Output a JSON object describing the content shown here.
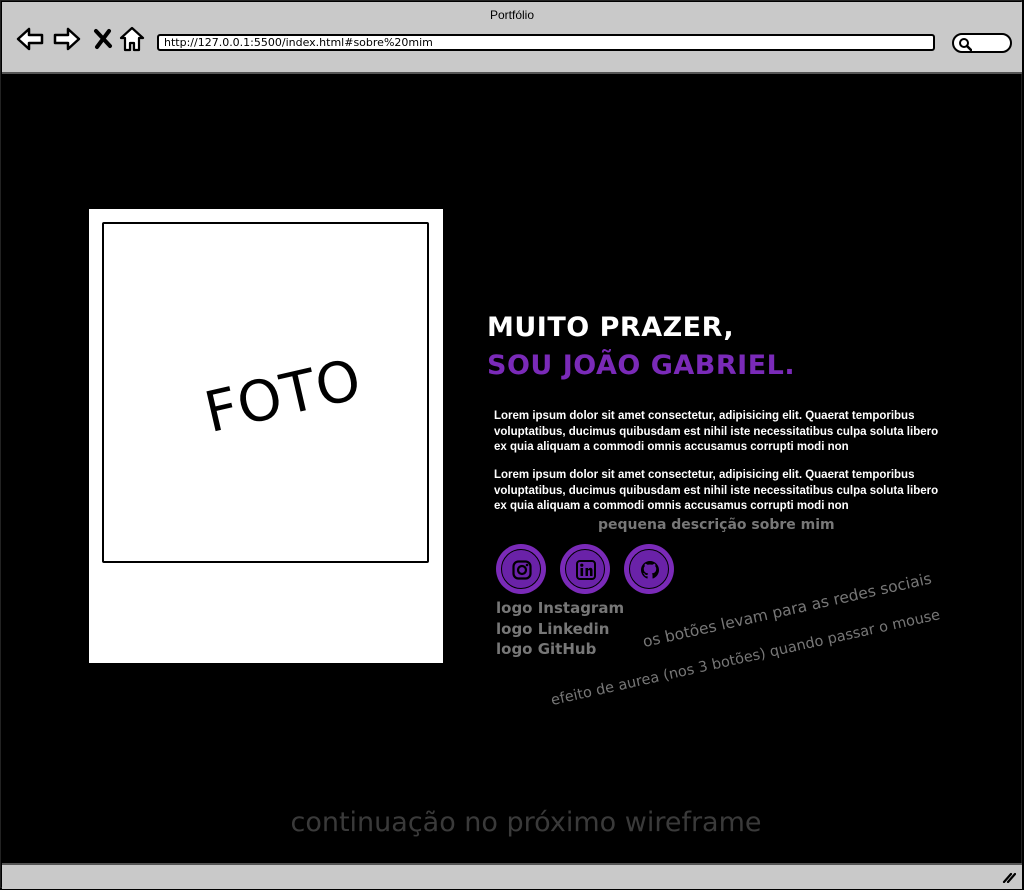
{
  "window": {
    "title": "Portfólio",
    "address": "http://127.0.0.1:5500/index.html#sobre%20mim"
  },
  "photo": {
    "label": "FOTO"
  },
  "heading": {
    "line1": "MUITO PRAZER,",
    "line2": "SOU JOÃO GABRIEL."
  },
  "paragraphs": [
    "Lorem ipsum dolor sit amet consectetur, adipisicing elit. Quaerat temporibus voluptatibus, ducimus quibusdam est nihil iste necessitatibus culpa soluta libero ex quia aliquam a commodi omnis accusamus corrupti modi non",
    "Lorem ipsum dolor sit amet consectetur, adipisicing elit. Quaerat temporibus voluptatibus, ducimus quibusdam est nihil iste necessitatibus culpa soluta libero ex quia aliquam a commodi omnis accusamus corrupti modi non"
  ],
  "description_note": "pequena descrição sobre mim",
  "social": {
    "icons": [
      "instagram-icon",
      "linkedin-icon",
      "github-icon"
    ],
    "labels": [
      "logo Instagram",
      "logo Linkedin",
      "logo GitHub"
    ]
  },
  "annotations": {
    "redes": "os botões levam para as redes sociais",
    "efeito": "efeito de aurea (nos 3 botões) quando passar o mouse"
  },
  "continuation": "continuação no próximo wireframe",
  "colors": {
    "accent": "#7a2ab8",
    "background": "#000000",
    "chrome": "#c9c9c9",
    "note_text": "#777777"
  }
}
